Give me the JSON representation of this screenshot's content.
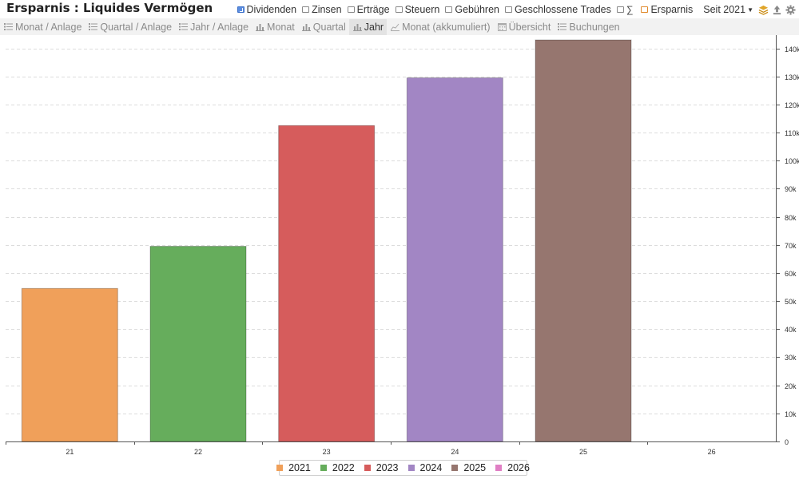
{
  "header": {
    "title": "Ersparnis : Liquides Vermögen",
    "toggles": [
      {
        "label": "Dividenden",
        "checked": true
      },
      {
        "label": "Zinsen",
        "checked": false
      },
      {
        "label": "Erträge",
        "checked": false
      },
      {
        "label": "Steuern",
        "checked": false
      },
      {
        "label": "Gebühren",
        "checked": false
      },
      {
        "label": "Geschlossene Trades",
        "checked": false
      },
      {
        "label": "∑",
        "checked": false
      },
      {
        "label": "Ersparnis",
        "checked": false
      }
    ],
    "period_label": "Seit 2021",
    "icons": [
      "layers-icon",
      "export-icon",
      "settings-icon"
    ]
  },
  "tabs": [
    {
      "label": "Monat / Anlage",
      "icon": "list-icon",
      "active": false
    },
    {
      "label": "Quartal / Anlage",
      "icon": "list-icon",
      "active": false
    },
    {
      "label": "Jahr / Anlage",
      "icon": "list-icon",
      "active": false
    },
    {
      "label": "Monat",
      "icon": "bar-chart-icon",
      "active": false
    },
    {
      "label": "Quartal",
      "icon": "bar-chart-icon",
      "active": false
    },
    {
      "label": "Jahr",
      "icon": "bar-chart-icon",
      "active": true
    },
    {
      "label": "Monat (akkumuliert)",
      "icon": "line-chart-icon",
      "active": false
    },
    {
      "label": "Übersicht",
      "icon": "calendar-icon",
      "active": false
    },
    {
      "label": "Buchungen",
      "icon": "list-icon",
      "active": false
    }
  ],
  "chart_data": {
    "type": "bar",
    "categories": [
      "21",
      "22",
      "23",
      "24",
      "25",
      "26"
    ],
    "values": [
      54500,
      69500,
      112500,
      129500,
      143000,
      0
    ],
    "colors": [
      "#f0a05a",
      "#66ad5c",
      "#d65c5c",
      "#a286c4",
      "#96766f",
      "#e07fc4"
    ],
    "ylim": [
      0,
      143000
    ],
    "yticks": [
      0,
      10000,
      20000,
      30000,
      40000,
      50000,
      60000,
      70000,
      80000,
      90000,
      100000,
      110000,
      120000,
      130000,
      140000
    ],
    "ytick_labels": [
      "0",
      "10k",
      "20k",
      "30k",
      "40k",
      "50k",
      "60k",
      "70k",
      "80k",
      "90k",
      "100k",
      "110k",
      "120k",
      "130k",
      "140k"
    ],
    "y_axis_side": "right",
    "grid": true,
    "legend": {
      "position": "bottom-center",
      "entries": [
        {
          "label": "2021",
          "color": "#f0a05a"
        },
        {
          "label": "2022",
          "color": "#66ad5c"
        },
        {
          "label": "2023",
          "color": "#d65c5c"
        },
        {
          "label": "2024",
          "color": "#a286c4"
        },
        {
          "label": "2025",
          "color": "#96766f"
        },
        {
          "label": "2026",
          "color": "#e07fc4"
        }
      ]
    }
  }
}
